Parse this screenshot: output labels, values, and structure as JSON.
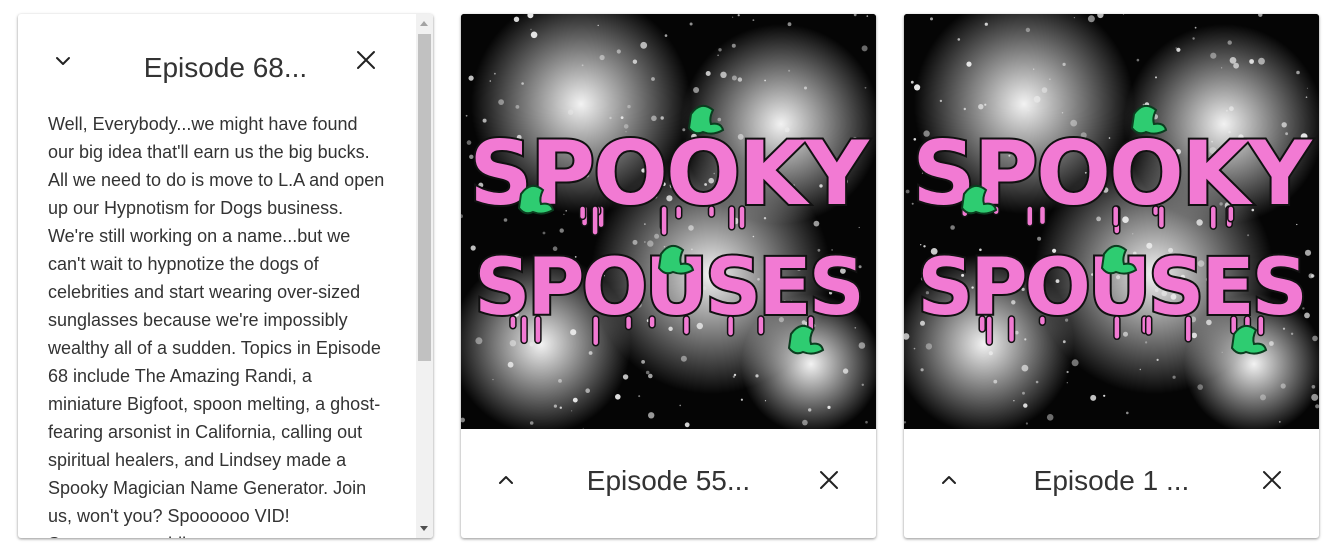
{
  "cards": [
    {
      "title": "Episode 68...",
      "expanded": true,
      "description": "Well, Everybody...we might have found our big idea that'll earn us the big bucks. All we need to do is move to L.A and open up our Hypnotism for Dogs business. We're still working on a name...but we can't wait to hypnotize the dogs of celebrities and start wearing over-sized sunglasses because we're impossibly wealthy all of a sudden. Topics in Episode 68 include The Amazing Randi, a miniature Bigfoot, spoon melting, a ghost-fearing arsonist in California, calling out spiritual healers, and Lindsey made a Spooky Magician Name Generator. Join us, won't you? Spoooooo VID! Spoooooooo widi..."
    },
    {
      "title": "Episode 55...",
      "expanded": false,
      "art_text_line1": "SPOOKY",
      "art_text_line2": "SPOUSES"
    },
    {
      "title": "Episode 1 ...",
      "expanded": false,
      "art_text_line1": "SPOOKY",
      "art_text_line2": "SPOUSES"
    }
  ],
  "colors": {
    "art_pink": "#f27ad3",
    "art_green": "#2ecc71",
    "text": "#333333"
  },
  "icons": {
    "collapse": "chevron-down-icon",
    "expand": "chevron-up-icon",
    "close": "close-icon"
  }
}
